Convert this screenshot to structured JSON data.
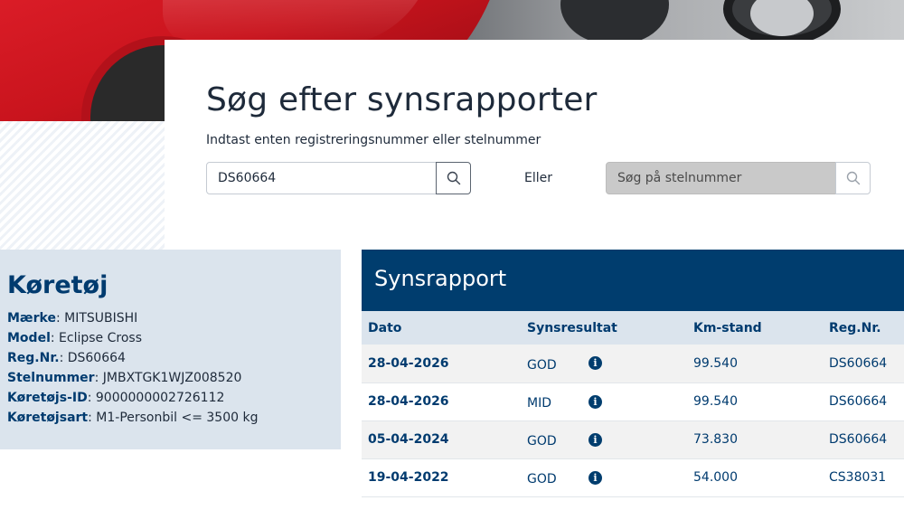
{
  "search": {
    "title": "Søg efter synsrapporter",
    "subtitle": "Indtast enten registreringsnummer eller stelnummer",
    "reg_value": "DS60664",
    "or_label": "Eller",
    "vin_placeholder": "Søg på stelnummer"
  },
  "vehicle": {
    "title": "Køretøj",
    "fields": [
      {
        "label": "Mærke",
        "value": "MITSUBISHI"
      },
      {
        "label": "Model",
        "value": "Eclipse Cross"
      },
      {
        "label": "Reg.Nr.",
        "value": "DS60664"
      },
      {
        "label": "Stelnummer",
        "value": "JMBXTGK1WJZ008520"
      },
      {
        "label": "Køretøjs-ID",
        "value": "9000000002726112"
      },
      {
        "label": "Køretøjsart",
        "value": "M1-Personbil <= 3500 kg"
      }
    ]
  },
  "report": {
    "title": "Synsrapport",
    "columns": [
      "Dato",
      "Synsresultat",
      "Km-stand",
      "Reg.Nr."
    ],
    "rows": [
      {
        "date": "28-04-2026",
        "result": "GOD",
        "km": "99.540",
        "reg": "DS60664"
      },
      {
        "date": "28-04-2026",
        "result": "MID",
        "km": "99.540",
        "reg": "DS60664"
      },
      {
        "date": "05-04-2024",
        "result": "GOD",
        "km": "73.830",
        "reg": "DS60664"
      },
      {
        "date": "19-04-2022",
        "result": "GOD",
        "km": "54.000",
        "reg": "CS38031"
      }
    ]
  },
  "icons": {
    "search": "search-icon",
    "info": "info-icon"
  },
  "colors": {
    "primary": "#003d6e",
    "panel_bg": "#dbe4ed",
    "disabled_input": "#c9c9c9"
  }
}
